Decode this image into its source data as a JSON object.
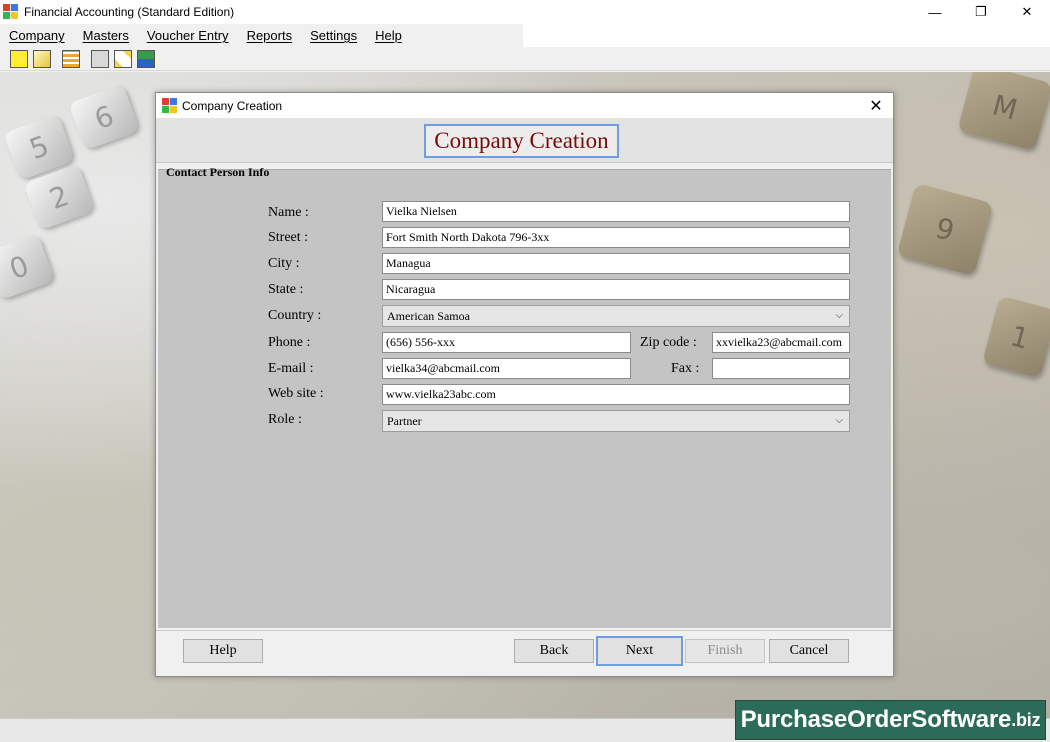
{
  "window": {
    "title": "Financial Accounting (Standard Edition)",
    "minimize_glyph": "—",
    "restore_glyph": "❐",
    "close_glyph": "✕"
  },
  "menu": {
    "items": [
      {
        "label": "Company"
      },
      {
        "label": "Masters"
      },
      {
        "label": "Voucher Entry"
      },
      {
        "label": "Reports"
      },
      {
        "label": "Settings"
      },
      {
        "label": "Help"
      }
    ]
  },
  "toolbar": {
    "icons": [
      "new-company-icon",
      "open-company-icon",
      "calculator-icon",
      "accounts-icon",
      "diamond-tool-icon",
      "backup-icon"
    ]
  },
  "background": {
    "keys": [
      "6",
      "5",
      "2",
      "0",
      "9",
      "1",
      "M"
    ]
  },
  "dialog": {
    "title": "Company Creation",
    "close_glyph": "✕",
    "header": "Company Creation",
    "section_caption": "Contact Person Info",
    "form": {
      "name_label": "Name :",
      "name_value": "Vielka Nielsen",
      "street_label": "Street :",
      "street_value": "Fort Smith North Dakota 796-3xx",
      "city_label": "City :",
      "city_value": "Managua",
      "state_label": "State :",
      "state_value": "Nicaragua",
      "country_label": "Country :",
      "country_value": "American Samoa",
      "phone_label": "Phone :",
      "phone_value": "(656) 556-xxx",
      "zip_label": "Zip code :",
      "zip_value": "xxvielka23@abcmail.com",
      "email_label": "E-mail :",
      "email_value": "vielka34@abcmail.com",
      "fax_label": "Fax :",
      "fax_value": "",
      "website_label": "Web site :",
      "website_value": "www.vielka23abc.com",
      "role_label": "Role :",
      "role_value": "Partner",
      "chevron_glyph": "⌵"
    },
    "buttons": {
      "help": "Help",
      "back": "Back",
      "next": "Next",
      "finish": "Finish",
      "cancel": "Cancel"
    }
  },
  "watermark": {
    "text": "PurchaseOrderSoftware",
    "suffix": ".biz"
  }
}
